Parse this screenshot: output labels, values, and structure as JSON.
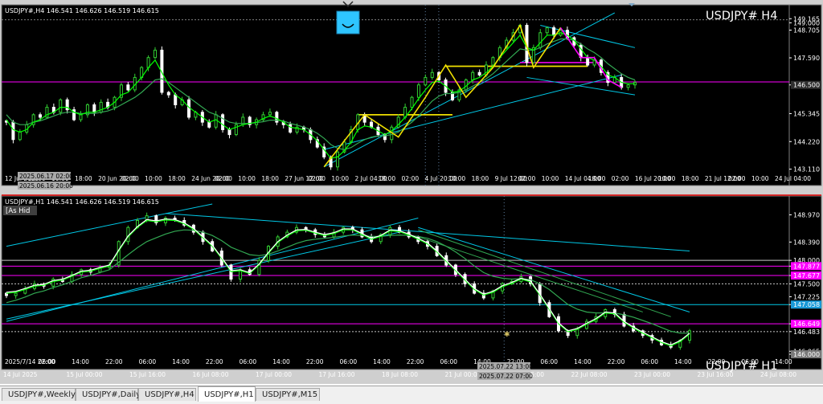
{
  "app": {
    "tabs": [
      {
        "label": "USDJPY#,Weekly",
        "active": false
      },
      {
        "label": "USDJPY#,Daily",
        "active": false
      },
      {
        "label": "USDJPY#,H4",
        "active": false
      },
      {
        "label": "USDJPY#,H1",
        "active": true
      },
      {
        "label": "USDJPY#,M15",
        "active": false
      }
    ]
  },
  "colors": {
    "background": "#000000",
    "axis_background": "#000000",
    "text": "#ffffff",
    "grid": "#c8c8c8",
    "up_candle": "#32cd32",
    "down_candle": "#ffffff",
    "ma_fast": "#00ff00",
    "ma_slow": "#32a852",
    "ma_white": "#ffffff",
    "channel": "#00c8e6",
    "yellow_lines": "#f0e000",
    "magenta": "#ff00ff",
    "red_border": "#e00000"
  },
  "chart_data": [
    {
      "type": "candlestick",
      "info": "USDJPY#,H4  146.541 146.626 146.519 146.615",
      "label": "USDJPY#  H4",
      "price_ticks": [
        "149.165",
        "149.000",
        "148.705",
        "147.590",
        "146.500",
        "145.345",
        "144.220",
        "143.110"
      ],
      "time_ticks": [
        "12 Jul 2025",
        "02:00",
        "10:00",
        "18:00",
        "20 Jun 20:00",
        "02:00",
        "10:00",
        "18:00",
        "24 Jun 20:00",
        "02:00",
        "10:00",
        "18:00",
        "27 Jun 12:00",
        "02:00",
        "10:00",
        "2 Jul 04:00",
        "18:00",
        "02:00",
        "4 Jul 20:00",
        "10:00",
        "18:00",
        "9 Jul 12:00",
        "02:00",
        "10:00",
        "14 Jul 04:00",
        "18:00",
        "02:00",
        "16 Jul 20:00",
        "10:00",
        "18:00",
        "21 Jul 12:00",
        "02:00",
        "10:00",
        "24 Jul 04:00"
      ],
      "crosshair_labels": [
        "2025.06.17 02:00",
        "2025.06.16 20:00"
      ],
      "ylim": [
        143.0,
        149.4
      ],
      "close": [
        145.0,
        144.3,
        144.6,
        144.9,
        145.3,
        145.2,
        145.6,
        145.4,
        145.9,
        145.5,
        145.1,
        145.3,
        145.7,
        145.4,
        145.8,
        145.6,
        146.0,
        146.5,
        146.3,
        146.8,
        147.2,
        147.6,
        147.9,
        146.2,
        146.1,
        145.7,
        145.9,
        145.2,
        145.4,
        145.0,
        144.8,
        145.3,
        144.7,
        144.5,
        144.9,
        145.2,
        144.9,
        145.1,
        145.3,
        145.4,
        145.0,
        144.9,
        144.6,
        144.8,
        144.7,
        144.3,
        144.0,
        143.6,
        143.2,
        143.8,
        144.2,
        144.7,
        145.3,
        145.0,
        144.8,
        144.5,
        144.3,
        144.8,
        145.2,
        145.6,
        146.0,
        146.5,
        146.8,
        147.0,
        146.7,
        146.2,
        145.9,
        146.3,
        146.7,
        147.0,
        146.9,
        147.3,
        147.6,
        148.0,
        148.3,
        148.6,
        148.9,
        147.4,
        148.0,
        148.6,
        148.8,
        148.5,
        148.7,
        148.4,
        148.1,
        147.6,
        147.3,
        147.5,
        147.0,
        146.6,
        146.8,
        146.4,
        146.5,
        146.6
      ],
      "ma_fast": [
        145.1,
        144.7,
        144.6,
        144.7,
        145.0,
        145.1,
        145.3,
        145.4,
        145.6,
        145.6,
        145.4,
        145.3,
        145.4,
        145.4,
        145.5,
        145.6,
        145.8,
        146.1,
        146.2,
        146.5,
        146.8,
        147.2,
        147.5,
        147.0,
        146.5,
        146.1,
        145.9,
        145.6,
        145.4,
        145.2,
        145.0,
        145.1,
        144.9,
        144.7,
        144.8,
        144.9,
        144.95,
        145.0,
        145.15,
        145.25,
        145.15,
        145.0,
        144.8,
        144.75,
        144.7,
        144.5,
        144.25,
        143.9,
        143.55,
        143.6,
        143.85,
        144.2,
        144.7,
        144.85,
        144.8,
        144.65,
        144.5,
        144.65,
        144.9,
        145.2,
        145.55,
        145.95,
        146.3,
        146.6,
        146.65,
        146.45,
        146.2,
        146.25,
        146.45,
        146.7,
        146.8,
        147.0,
        147.25,
        147.6,
        147.9,
        148.2,
        148.5,
        148.0,
        147.9,
        148.2,
        148.5,
        148.5,
        148.6,
        148.5,
        148.3,
        147.95,
        147.6,
        147.5,
        147.25,
        146.9,
        146.8,
        146.6,
        146.55,
        146.55
      ],
      "ma_slow": [
        145.3,
        145.0,
        144.9,
        144.9,
        145.0,
        145.05,
        145.15,
        145.25,
        145.35,
        145.4,
        145.4,
        145.35,
        145.35,
        145.35,
        145.4,
        145.45,
        145.55,
        145.7,
        145.85,
        146.0,
        146.2,
        146.45,
        146.7,
        146.75,
        146.6,
        146.4,
        146.2,
        146.0,
        145.8,
        145.6,
        145.4,
        145.3,
        145.15,
        145.0,
        144.95,
        144.95,
        144.95,
        144.98,
        145.02,
        145.08,
        145.08,
        145.05,
        144.95,
        144.88,
        144.8,
        144.7,
        144.55,
        144.35,
        144.1,
        143.95,
        143.9,
        143.98,
        144.15,
        144.3,
        144.4,
        144.45,
        144.45,
        144.5,
        144.6,
        144.8,
        145.0,
        145.25,
        145.55,
        145.85,
        146.05,
        146.15,
        146.15,
        146.2,
        146.3,
        146.45,
        146.6,
        146.75,
        146.95,
        147.2,
        147.45,
        147.7,
        147.95,
        147.9,
        147.9,
        148.0,
        148.15,
        148.25,
        148.35,
        148.35,
        148.3,
        148.15,
        147.95,
        147.8,
        147.6,
        147.35,
        147.15,
        146.95,
        146.8,
        146.7
      ]
    },
    {
      "type": "candlestick",
      "info": "USDJPY#,H1  146.541 146.626 146.519 146.615",
      "label": "USDJPY#  H1",
      "indicator_label": "[As Hid",
      "price_ticks": [
        "148.970",
        "148.390",
        "148.000",
        "147.877",
        "147.677",
        "147.500",
        "147.225",
        "147.058",
        "146.649",
        "146.483",
        "146.065",
        "146.000"
      ],
      "time_ticks": [
        "2025/7/14 22:00",
        "06:00",
        "14:00",
        "22:00",
        "06:00",
        "14:00",
        "22:00",
        "06:00",
        "14:00",
        "22:00",
        "06:00",
        "14:00",
        "22:00",
        "06:00",
        "14:00",
        "22:00",
        "06:00",
        "14:00",
        "22:00",
        "06:00",
        "14:00",
        "22:00",
        "06:00",
        "14:00"
      ],
      "date_ticks": [
        "14 Jul 2025",
        "15 Jul 00:00",
        "15 Jul 16:00",
        "16 Jul 08:00",
        "17 Jul 00:00",
        "17 Jul 16:00",
        "18 Jul 08:00",
        "21 Jul 00:00",
        "21 Jul 16:00",
        "22 Jul 08:00",
        "23 Jul 00:00",
        "23 Jul 16:00",
        "24 Jul 08:00"
      ],
      "crosshair_labels": [
        "2025.07.22 13:00",
        "2025.07.22 07:00"
      ],
      "ylim": [
        145.95,
        149.2
      ],
      "close": [
        147.25,
        147.3,
        147.4,
        147.5,
        147.45,
        147.6,
        147.55,
        147.7,
        147.8,
        147.75,
        147.85,
        147.9,
        148.4,
        148.7,
        148.85,
        148.95,
        148.8,
        148.9,
        148.85,
        148.75,
        148.6,
        148.4,
        148.2,
        147.9,
        147.6,
        147.8,
        147.7,
        148.0,
        148.3,
        148.5,
        148.6,
        148.7,
        148.65,
        148.55,
        148.5,
        148.6,
        148.7,
        148.65,
        148.5,
        148.4,
        148.55,
        148.7,
        148.6,
        148.5,
        148.4,
        148.3,
        148.1,
        147.9,
        147.7,
        147.5,
        147.3,
        147.2,
        147.35,
        147.5,
        147.55,
        147.65,
        147.5,
        147.1,
        146.8,
        146.5,
        146.4,
        146.55,
        146.7,
        146.8,
        146.95,
        146.85,
        146.6,
        146.5,
        146.4,
        146.3,
        146.2,
        146.15,
        146.3,
        146.5
      ],
      "ma_fast": [
        147.3,
        147.32,
        147.38,
        147.45,
        147.47,
        147.55,
        147.58,
        147.66,
        147.75,
        147.77,
        147.83,
        147.88,
        148.2,
        148.5,
        148.7,
        148.85,
        148.82,
        148.86,
        148.85,
        148.78,
        148.66,
        148.48,
        148.3,
        148.04,
        147.76,
        147.78,
        147.72,
        147.9,
        148.15,
        148.38,
        148.52,
        148.63,
        148.64,
        148.58,
        148.53,
        148.57,
        148.65,
        148.65,
        148.55,
        148.45,
        148.51,
        148.63,
        148.61,
        148.54,
        148.45,
        148.35,
        148.18,
        147.98,
        147.78,
        147.58,
        147.38,
        147.26,
        147.32,
        147.44,
        147.51,
        147.6,
        147.54,
        147.26,
        146.96,
        146.65,
        146.48,
        146.53,
        146.64,
        146.74,
        146.88,
        146.86,
        146.68,
        146.56,
        146.45,
        146.35,
        146.25,
        146.18,
        146.27,
        146.43
      ],
      "ma_slow": [
        147.1,
        147.15,
        147.22,
        147.3,
        147.35,
        147.42,
        147.48,
        147.55,
        147.63,
        147.68,
        147.74,
        147.8,
        147.96,
        148.12,
        148.27,
        148.4,
        148.48,
        148.56,
        148.62,
        148.65,
        148.64,
        148.6,
        148.53,
        148.42,
        148.28,
        148.2,
        148.12,
        148.1,
        148.13,
        148.2,
        148.28,
        148.36,
        148.42,
        148.45,
        148.47,
        148.49,
        148.52,
        148.54,
        148.53,
        148.51,
        148.51,
        148.53,
        148.54,
        148.53,
        148.51,
        148.47,
        148.4,
        148.3,
        148.18,
        148.04,
        147.88,
        147.74,
        147.66,
        147.62,
        147.6,
        147.61,
        147.59,
        147.5,
        147.38,
        147.22,
        147.06,
        146.96,
        146.9,
        146.88,
        146.88,
        146.88,
        146.84,
        146.79,
        146.72,
        146.65,
        146.57,
        146.49,
        146.45,
        146.45
      ]
    }
  ]
}
